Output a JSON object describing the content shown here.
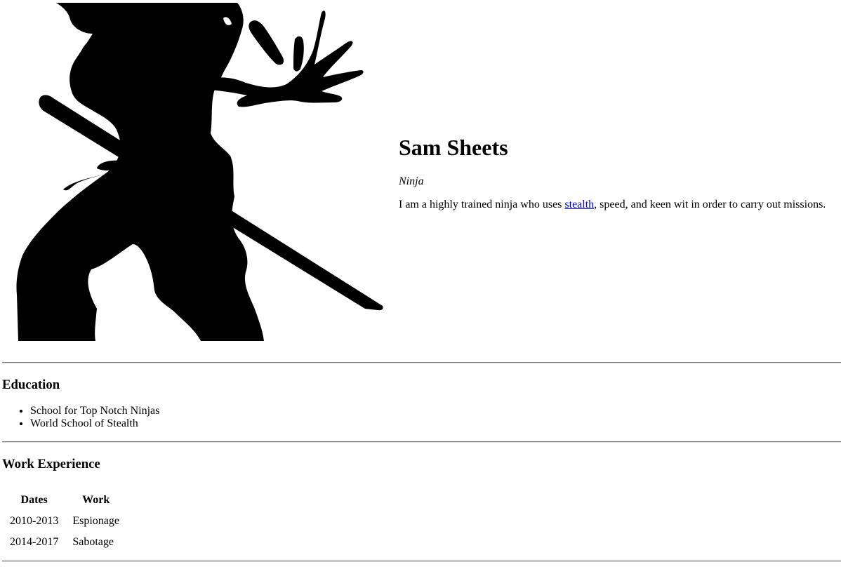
{
  "profile": {
    "name": "Sam Sheets",
    "title": "Ninja",
    "bio_before": "I am a highly trained ninja who uses ",
    "bio_link": "stealth",
    "bio_after": ", speed, and keen wit in order to carry out missions."
  },
  "education": {
    "heading": "Education",
    "items": [
      "School for Top Notch Ninjas",
      "World School of Stealth"
    ]
  },
  "work": {
    "heading": "Work Experience",
    "columns": [
      "Dates",
      "Work"
    ],
    "rows": [
      [
        "2010-2013",
        "Espionage"
      ],
      [
        "2014-2017",
        "Sabotage"
      ]
    ]
  },
  "colors": {
    "link": "#0000ee",
    "silhouette": "#000000",
    "rule": "#7a7a7a"
  },
  "icons": {
    "hero_image": "ninja-silhouette"
  }
}
